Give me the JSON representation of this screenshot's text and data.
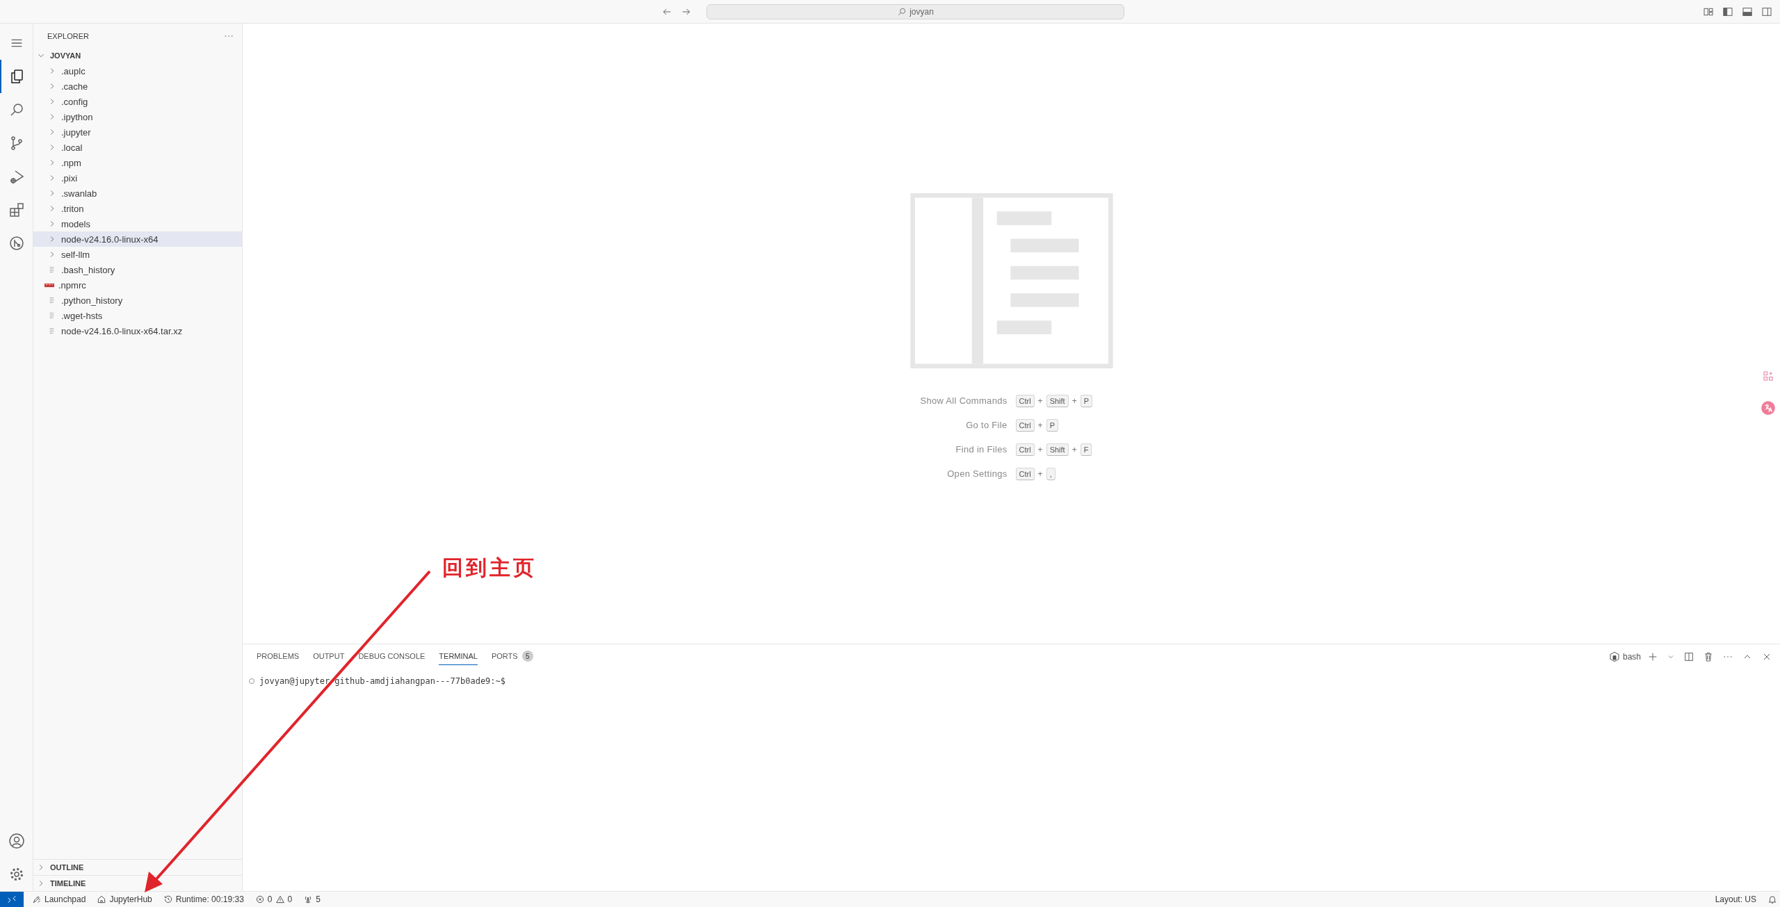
{
  "title_bar": {
    "search": "jovyan"
  },
  "activity_bar": {
    "top": [
      {
        "kind": "explorer",
        "selected": true
      },
      {
        "kind": "search",
        "selected": false
      },
      {
        "kind": "source-control",
        "selected": false
      },
      {
        "kind": "run-debug",
        "selected": false
      },
      {
        "kind": "extensions",
        "selected": false
      },
      {
        "kind": "git-graph",
        "selected": false
      }
    ],
    "bottom": [
      {
        "kind": "account"
      },
      {
        "kind": "settings"
      }
    ]
  },
  "sidebar": {
    "title": "EXPLORER",
    "root": {
      "label": "JOVYAN",
      "expanded": true,
      "children": [
        {
          "label": ".auplc",
          "kind": "folder",
          "expanded": false,
          "selected": false
        },
        {
          "label": ".cache",
          "kind": "folder",
          "expanded": false,
          "selected": false
        },
        {
          "label": ".config",
          "kind": "folder",
          "expanded": false,
          "selected": false
        },
        {
          "label": ".ipython",
          "kind": "folder",
          "expanded": false,
          "selected": false
        },
        {
          "label": ".jupyter",
          "kind": "folder",
          "expanded": false,
          "selected": false
        },
        {
          "label": ".local",
          "kind": "folder",
          "expanded": false,
          "selected": false
        },
        {
          "label": ".npm",
          "kind": "folder",
          "expanded": false,
          "selected": false
        },
        {
          "label": ".pixi",
          "kind": "folder",
          "expanded": false,
          "selected": false
        },
        {
          "label": ".swanlab",
          "kind": "folder",
          "expanded": false,
          "selected": false
        },
        {
          "label": ".triton",
          "kind": "folder",
          "expanded": false,
          "selected": false
        },
        {
          "label": "models",
          "kind": "folder",
          "expanded": false,
          "selected": false
        },
        {
          "label": "node-v24.16.0-linux-x64",
          "kind": "folder",
          "expanded": false,
          "selected": true
        },
        {
          "label": "self-llm",
          "kind": "folder",
          "expanded": false,
          "selected": false
        },
        {
          "label": ".bash_history",
          "kind": "file",
          "selected": false
        },
        {
          "label": ".npmrc",
          "kind": "npm",
          "selected": false
        },
        {
          "label": ".python_history",
          "kind": "file",
          "selected": false
        },
        {
          "label": ".wget-hsts",
          "kind": "file",
          "selected": false
        },
        {
          "label": "node-v24.16.0-linux-x64.tar.xz",
          "kind": "file",
          "selected": false
        }
      ]
    },
    "sections": [
      {
        "label": "OUTLINE",
        "expanded": false
      },
      {
        "label": "TIMELINE",
        "expanded": false
      }
    ]
  },
  "welcome": {
    "shortcuts": [
      {
        "label": "Show All Commands",
        "keys": [
          {
            "kind": "key",
            "text": "Ctrl"
          },
          {
            "kind": "plus",
            "text": "+"
          },
          {
            "kind": "key",
            "text": "Shift"
          },
          {
            "kind": "plus",
            "text": "+"
          },
          {
            "kind": "key",
            "text": "P"
          }
        ]
      },
      {
        "label": "Go to File",
        "keys": [
          {
            "kind": "key",
            "text": "Ctrl"
          },
          {
            "kind": "plus",
            "text": "+"
          },
          {
            "kind": "key",
            "text": "P"
          }
        ]
      },
      {
        "label": "Find in Files",
        "keys": [
          {
            "kind": "key",
            "text": "Ctrl"
          },
          {
            "kind": "plus",
            "text": "+"
          },
          {
            "kind": "key",
            "text": "Shift"
          },
          {
            "kind": "plus",
            "text": "+"
          },
          {
            "kind": "key",
            "text": "F"
          }
        ]
      },
      {
        "label": "Open Settings",
        "keys": [
          {
            "kind": "key",
            "text": "Ctrl"
          },
          {
            "kind": "plus",
            "text": "+"
          },
          {
            "kind": "key",
            "text": ","
          }
        ]
      }
    ]
  },
  "panel": {
    "tabs": [
      {
        "label": "PROBLEMS",
        "selected": false
      },
      {
        "label": "OUTPUT",
        "selected": false
      },
      {
        "label": "DEBUG CONSOLE",
        "selected": false
      },
      {
        "label": "TERMINAL",
        "selected": true
      },
      {
        "label": "PORTS",
        "selected": false,
        "badge": "5"
      }
    ],
    "terminal_name": "bash",
    "terminal_lines": [
      "jovyan@jupyter-github-amdjiahangpan---77b0ade9:~$"
    ]
  },
  "status_bar": {
    "left": [
      {
        "kind": "remote"
      },
      {
        "kind": "launchpad",
        "label": "Launchpad"
      },
      {
        "kind": "home",
        "label": "JupyterHub"
      },
      {
        "kind": "history",
        "label": "Runtime: 00:19:33"
      },
      {
        "kind": "problems",
        "errors": "0",
        "warnings": "0"
      },
      {
        "kind": "ports",
        "label": "5"
      }
    ],
    "right": [
      {
        "kind": "layout",
        "label": "Layout: US"
      },
      {
        "kind": "bell"
      }
    ]
  },
  "annotation": {
    "text": "回到主页"
  }
}
